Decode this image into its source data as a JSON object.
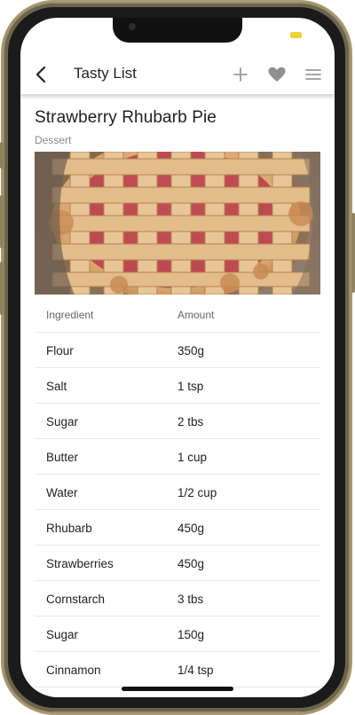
{
  "appbar": {
    "title": "Tasty List",
    "icons": [
      "back-arrow-icon",
      "plus-icon",
      "heart-icon",
      "menu-icon"
    ]
  },
  "recipe": {
    "title": "Strawberry Rhubarb Pie",
    "category": "Dessert",
    "image": "lattice-pie-photo"
  },
  "table": {
    "headers": [
      "Ingredient",
      "Amount"
    ],
    "rows": [
      [
        "Flour",
        "350g"
      ],
      [
        "Salt",
        "1 tsp"
      ],
      [
        "Sugar",
        "2 tbs"
      ],
      [
        "Butter",
        "1 cup"
      ],
      [
        "Water",
        "1/2 cup"
      ],
      [
        "Rhubarb",
        "450g"
      ],
      [
        "Strawberries",
        "450g"
      ],
      [
        "Cornstarch",
        "3 tbs"
      ],
      [
        "Sugar",
        "150g"
      ],
      [
        "Cinnamon",
        "1/4 tsp"
      ]
    ]
  },
  "colors": {
    "frame": "#9c8e66",
    "battery": "#f2d23a",
    "icon_gray": "#9a9a9a"
  }
}
